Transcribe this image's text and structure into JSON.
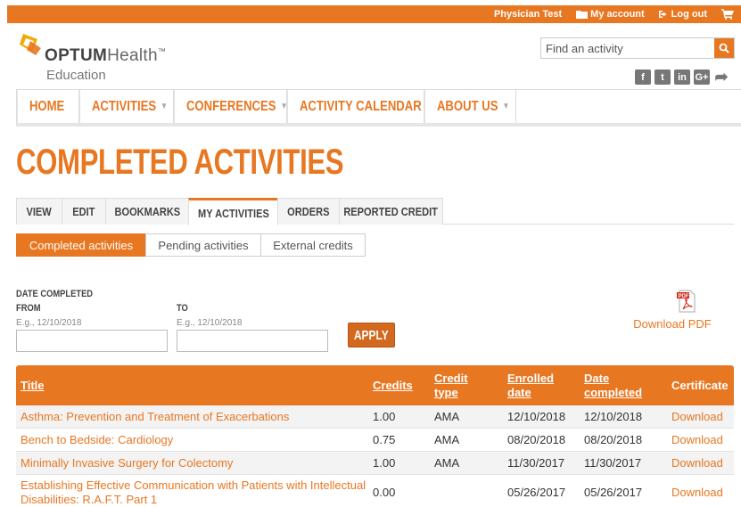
{
  "topbar": {
    "user": "Physician Test",
    "account": "My account",
    "logout": "Log out"
  },
  "logo": {
    "brand_bold": "OPTUM",
    "brand_light": "Health",
    "tm": "™",
    "sub": "Education"
  },
  "search": {
    "placeholder": "Find an activity"
  },
  "social": [
    "f",
    "t",
    "in",
    "G+"
  ],
  "nav": {
    "home": "HOME",
    "activities": "ACTIVITIES",
    "conferences": "CONFERENCES",
    "calendar": "ACTIVITY CALENDAR",
    "about": "ABOUT US"
  },
  "page_title": "COMPLETED ACTIVITIES",
  "tabs": {
    "view": "VIEW",
    "edit": "EDIT",
    "bookmarks": "BOOKMARKS",
    "my_activities": "MY ACTIVITIES",
    "orders": "ORDERS",
    "reported_credit": "REPORTED CREDIT"
  },
  "subtabs": {
    "completed": "Completed activities",
    "pending": "Pending activities",
    "external": "External credits"
  },
  "filter": {
    "heading": "DATE COMPLETED",
    "from_label": "FROM",
    "from_hint": "E.g., 12/10/2018",
    "to_label": "TO",
    "to_hint": "E.g., 12/10/2018",
    "apply": "APPLY"
  },
  "pdf": {
    "icon_text": "PDF",
    "link": "Download PDF"
  },
  "table": {
    "headers": {
      "title": "Title",
      "credits": "Credits",
      "credit_type_1": "Credit",
      "credit_type_2": "type",
      "enrolled_1": "Enrolled",
      "enrolled_2": "date",
      "completed_1": "Date",
      "completed_2": "completed",
      "certificate": "Certificate"
    },
    "rows": [
      {
        "title": "Asthma: Prevention and Treatment of Exacerbations",
        "credits": "1.00",
        "type": "AMA",
        "enrolled": "12/10/2018",
        "completed": "12/10/2018",
        "cert": "Download"
      },
      {
        "title": "Bench to Bedside: Cardiology",
        "credits": "0.75",
        "type": "AMA",
        "enrolled": "08/20/2018",
        "completed": "08/20/2018",
        "cert": "Download"
      },
      {
        "title": "Minimally Invasive Surgery for Colectomy",
        "credits": "1.00",
        "type": "AMA",
        "enrolled": "11/30/2017",
        "completed": "11/30/2017",
        "cert": "Download"
      },
      {
        "title": "Establishing Effective Communication with Patients with Intellectual Disabilities: R.A.F.T. Part 1",
        "credits": "0.00",
        "type": "",
        "enrolled": "05/26/2017",
        "completed": "05/26/2017",
        "cert": "Download"
      }
    ]
  }
}
